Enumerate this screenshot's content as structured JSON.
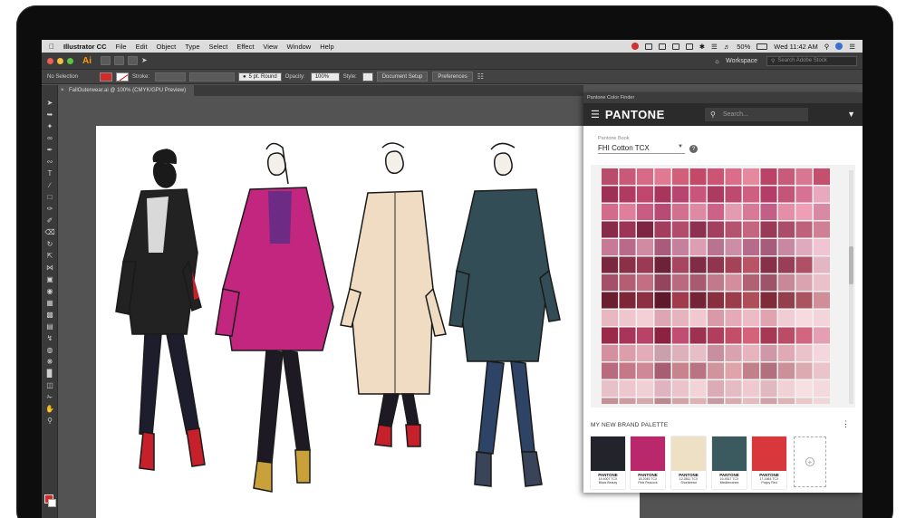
{
  "menubar": {
    "app_name": "Illustrator CC",
    "items": [
      "File",
      "Edit",
      "Object",
      "Type",
      "Select",
      "Effect",
      "View",
      "Window",
      "Help"
    ],
    "battery": "50%",
    "clock": "Wed 11:42 AM"
  },
  "appbar": {
    "logo": "Ai",
    "workspace": "Workspace",
    "stock_search_placeholder": "Search Adobe Stock"
  },
  "controlbar": {
    "selection": "No Selection",
    "stroke_label": "Stroke:",
    "brush": "5 pt. Round",
    "opacity_label": "Opacity:",
    "opacity_value": "100%",
    "style_label": "Style:",
    "document_setup": "Document Setup",
    "preferences": "Preferences"
  },
  "document": {
    "tab_title": "FallOuterwear.ai @ 100% (CMYK/GPU Preview)"
  },
  "pantone_panel": {
    "tab_title": "Pantone Color Finder",
    "brand": "PANTONE",
    "search_placeholder": "Search...",
    "book_label": "Pantone Book",
    "book_value": "FHI Cotton TCX",
    "palette_title": "MY NEW BRAND PALETTE",
    "palette": [
      {
        "brand": "PANTONE",
        "code": "19-4007 TCX",
        "name": "Black Beauty",
        "color": "#23242b"
      },
      {
        "brand": "PANTONE",
        "code": "18-2045 TCX",
        "name": "Pink Peacock",
        "color": "#b8286b"
      },
      {
        "brand": "PANTONE",
        "code": "12-0811 TCX",
        "name": "Shortbread",
        "color": "#ede0c4"
      },
      {
        "brand": "PANTONE",
        "code": "19-4517 TCX",
        "name": "Mediterranea",
        "color": "#3b5a60"
      },
      {
        "brand": "PANTONE",
        "code": "17-1664 TCX",
        "name": "Poppy Red",
        "color": "#d8383b"
      }
    ],
    "grid_colors": [
      [
        "#b84c6b",
        "#c95978",
        "#d66a87",
        "#e07a92",
        "#d05f7a",
        "#c24a68",
        "#cc5575",
        "#d96d8a",
        "#e48a9f",
        "#b94467",
        "#c85a7a",
        "#d87791",
        "#c4506f"
      ],
      [
        "#9e2f55",
        "#b03a62",
        "#c1476f",
        "#a8365c",
        "#b84470",
        "#c9557c",
        "#ad3a61",
        "#bd4a6f",
        "#cf5f80",
        "#b33d68",
        "#c55479",
        "#d87294",
        "#e8a8bd"
      ],
      [
        "#d46a8c",
        "#e07f9c",
        "#c95c82",
        "#b84b74",
        "#d2708f",
        "#de8aa4",
        "#cc6288",
        "#e29bb1",
        "#d77a98",
        "#c35f86",
        "#e48ea8",
        "#ee9fb6",
        "#d88aa5"
      ],
      [
        "#8a2a4a",
        "#9c3456",
        "#7e2544",
        "#a23d5e",
        "#b14c6a",
        "#8e3050",
        "#a3405f",
        "#b45270",
        "#c56681",
        "#993a57",
        "#ab4d68",
        "#bd627a",
        "#cf8094"
      ],
      [
        "#c77a95",
        "#b96a88",
        "#d08aa2",
        "#a85b7a",
        "#c5809b",
        "#dd9db2",
        "#b87390",
        "#cc8ea7",
        "#b56b89",
        "#a65d7c",
        "#c888a1",
        "#e0aabe",
        "#f0c4d2"
      ],
      [
        "#7a2840",
        "#8c3048",
        "#9a3a54",
        "#6e2238",
        "#a64660",
        "#7f2c44",
        "#91354e",
        "#a44258",
        "#b75466",
        "#86304a",
        "#9a3e57",
        "#af5066",
        "#e2b6c2"
      ],
      [
        "#a45068",
        "#b45e74",
        "#c46e82",
        "#94445c",
        "#ba6a80",
        "#a85a70",
        "#c07a8c",
        "#d38d9c",
        "#b06274",
        "#9e5468",
        "#c98898",
        "#dba3b0",
        "#eac0ca"
      ],
      [
        "#6a1e30",
        "#7c2638",
        "#8e3044",
        "#5e1a2a",
        "#a03c4c",
        "#742436",
        "#883040",
        "#9a3c4a",
        "#ae4e58",
        "#7e2c3a",
        "#94404c",
        "#aa5460",
        "#d08f98"
      ],
      [
        "#e8b8c2",
        "#eec6ce",
        "#f2d0d6",
        "#dca6b2",
        "#e6b4be",
        "#f0c8d0",
        "#d89aa8",
        "#e4aab6",
        "#ecbcc6",
        "#e0a4b0",
        "#f0ccd4",
        "#f6dadf",
        "#f2d4da"
      ],
      [
        "#9a2a4a",
        "#a8345a",
        "#b84268",
        "#8a2240",
        "#c04e72",
        "#9e3050",
        "#b03e5c",
        "#c24e68",
        "#d4627a",
        "#a63854",
        "#bc4c66",
        "#d26680",
        "#e4a0b2"
      ],
      [
        "#d4909e",
        "#dc9eaa",
        "#e4acb6",
        "#caa0ac",
        "#ddb0ba",
        "#e8bec6",
        "#c8909e",
        "#d8a2ae",
        "#e6b4bc",
        "#cf98a6",
        "#dfaab4",
        "#ecc2ca",
        "#f4d6dc"
      ],
      [
        "#b86a7e",
        "#c47888",
        "#d08896",
        "#a85e72",
        "#c8848e",
        "#b87480",
        "#d0949c",
        "#dea4aa",
        "#c2808a",
        "#b0707c",
        "#cc9098",
        "#dcaab0",
        "#eac4c8"
      ],
      [
        "#e8c0c8",
        "#ecc8ce",
        "#f0d0d4",
        "#e0b4be",
        "#eac4ca",
        "#f2d4d8",
        "#dcacb6",
        "#e6bcc4",
        "#eecad0",
        "#e2b8c0",
        "#f0d2d6",
        "#f6e0e2",
        "#f4dade"
      ],
      [
        "#c49098",
        "#cc9ca2",
        "#d4a8ac",
        "#bc8890",
        "#d2a4a8",
        "#dcb2b4",
        "#c69aa0",
        "#d6acb0",
        "#e2bcbe",
        "#cea2a8",
        "#dcb4b6",
        "#e8c8c8",
        "#f0d6d6"
      ]
    ]
  }
}
